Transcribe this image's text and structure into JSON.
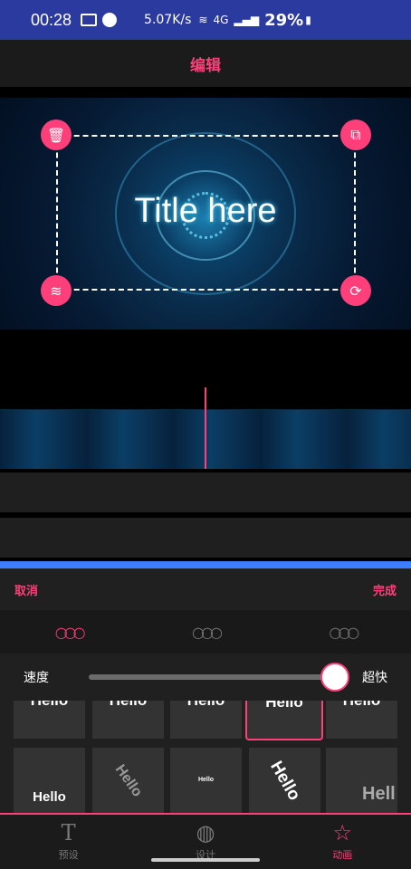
{
  "status_bar": {
    "time": "00:28",
    "network_speed": "5.07K/s",
    "signal": "4G",
    "battery": "29%"
  },
  "header": {
    "title": "编辑"
  },
  "preview": {
    "title_text": "Title here"
  },
  "panel": {
    "cancel_label": "取消",
    "done_label": "完成",
    "tabs": [
      {
        "icon": "animation-style-icon-1",
        "active": true
      },
      {
        "icon": "animation-style-icon-2",
        "active": false
      },
      {
        "icon": "animation-style-icon-3",
        "active": false
      }
    ],
    "speed_label": "速度",
    "speed_value": "超快",
    "speed_level": 0.95,
    "presets_row1": [
      "Hello",
      "Hello",
      "Hello",
      "Hello",
      "Hello"
    ],
    "presets_row2": [
      "Hello",
      "Hello",
      "Hello",
      "Hello",
      "Hell"
    ]
  },
  "nav": {
    "items": [
      {
        "label": "预设",
        "icon": "text-T-icon"
      },
      {
        "label": "设计",
        "icon": "palette-icon"
      },
      {
        "label": "动画",
        "icon": "animation-star-icon"
      }
    ]
  },
  "colors": {
    "accent": "#ff3f7a",
    "statusbar": "#2b3a9e",
    "highlight": "#3d7dff"
  }
}
